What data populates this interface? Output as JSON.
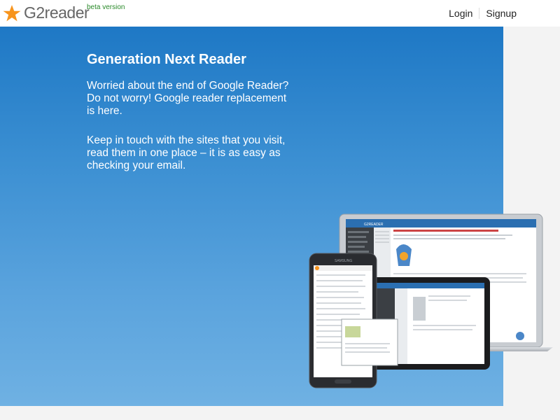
{
  "header": {
    "logo_text": "G2reader",
    "beta_label": "beta version",
    "login_label": "Login",
    "signup_label": "Signup"
  },
  "hero": {
    "title": "Generation Next Reader",
    "paragraph1": "Worried about the end of Google Reader? Do not worry! Google reader replacement is here.",
    "paragraph2": "Keep in touch with the sites that you visit, read them in one place – it is as easy as checking your email."
  },
  "devices_image": {
    "phone_brand": "SAMSUNG",
    "laptop_logo_text": "G2READER"
  },
  "colors": {
    "accent": "#f7941d",
    "hero_top": "#1e78c5",
    "hero_bottom": "#6fb1e3",
    "beta_green": "#2a8a2a"
  }
}
